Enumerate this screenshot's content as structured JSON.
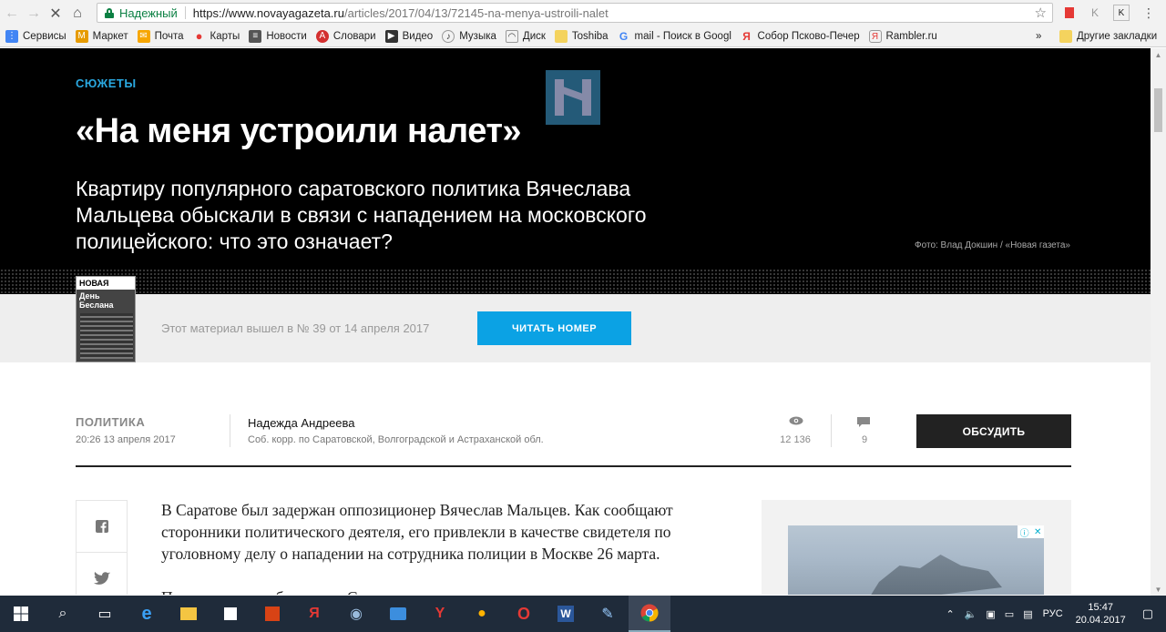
{
  "browser": {
    "secure_label": "Надежный",
    "url_host": "https://www.novayagazeta.ru",
    "url_path": "/articles/2017/04/13/72145-na-menya-ustroili-nalet",
    "bookmarks": [
      "Сервисы",
      "Маркет",
      "Почта",
      "Карты",
      "Новости",
      "Словари",
      "Видео",
      "Музыка",
      "Диск",
      "Toshiba",
      "mail - Поиск в Googl",
      "Собор Псково-Печер",
      "Rambler.ru"
    ],
    "more": "»",
    "other_bookmarks": "Другие закладки"
  },
  "hero": {
    "kicker": "СЮЖЕТЫ",
    "title": "«На меня устроили налет»",
    "lead": "Квартиру популярного саратовского политика Вячеслава Мальцева обыскали в связи с нападением на московского полицейского: что это означает?",
    "photo_credit": "Фото: Влад Докшин / «Новая газета»"
  },
  "issue": {
    "cover_mast": "НОВАЯ",
    "cover_headline": "День Беслана",
    "text": "Этот материал вышел в № 39 от 14 апреля 2017",
    "button": "ЧИТАТЬ НОМЕР"
  },
  "meta": {
    "rubric": "ПОЛИТИКА",
    "date": "20:26 13 апреля 2017",
    "author": "Надежда Андреева",
    "author_role": "Соб. корр. по Саратовской, Волгоградской и Астраханской обл.",
    "views": "12 136",
    "comments": "9",
    "discuss": "ОБСУДИТЬ"
  },
  "body": {
    "p1": "В Саратове был задержан оппозиционер Вячеслав Мальцев. Как сообщают сторонники политического деятеля, его привлекли в качестве свидетеля по уголовному делу о нападении на сотрудника полиции в Москве 26 марта.",
    "p2": "Представители областного Следственного управления пришли в квартиру"
  },
  "taskbar": {
    "lang": "РУС",
    "time": "15:47",
    "date": "20.04.2017"
  },
  "colors": {
    "accent": "#0ba2e4",
    "kicker": "#2aa8e0",
    "secure": "#0b8043"
  }
}
